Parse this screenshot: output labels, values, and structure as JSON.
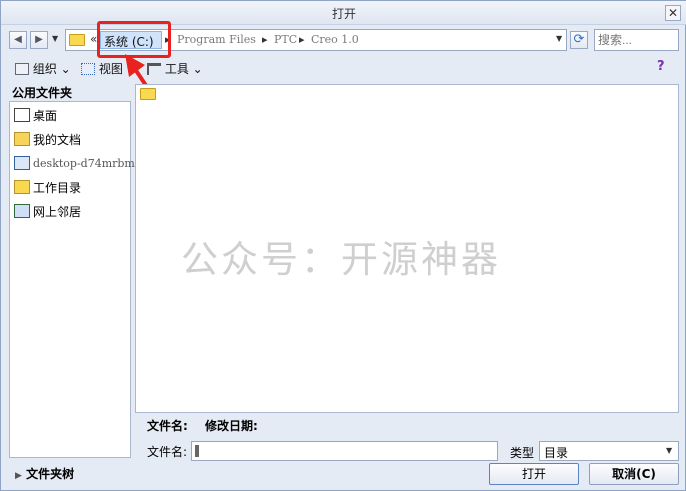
{
  "window": {
    "title": "打开",
    "close_glyph": "✕"
  },
  "nav": {
    "back_glyph": "◀",
    "forward_glyph": "▶",
    "dropdown_glyph": "▼",
    "refresh_glyph": "⟳"
  },
  "address": {
    "overflow_glyph": "«",
    "selected": "系统 (C:)",
    "sep": "▸",
    "crumbs": [
      "Program Files",
      "PTC",
      "Creo 1.0"
    ],
    "dropdown_glyph": "▼"
  },
  "search": {
    "placeholder": "搜索..."
  },
  "toolbar": {
    "organize": "组织",
    "view": "视图",
    "tools": "工具",
    "chevron": "⌄",
    "help_glyph": "?"
  },
  "sidebar": {
    "header": "公用文件夹",
    "items": [
      {
        "label": "桌面",
        "icon": "desktop-icon"
      },
      {
        "label": "我的文档",
        "icon": "documents-icon"
      },
      {
        "label": "desktop-d74mrbm",
        "icon": "computer-icon"
      },
      {
        "label": "工作目录",
        "icon": "working-directory-icon"
      },
      {
        "label": "网上邻居",
        "icon": "network-icon"
      }
    ],
    "folder_tree_label": "文件夹树",
    "folder_tree_glyph": "▶"
  },
  "file_list": {
    "watermark": "公众号：开源神器",
    "col_name": "文件名:",
    "col_modified": "修改日期:"
  },
  "bottom": {
    "filename_label": "文件名:",
    "filename_value": "",
    "type_label": "类型",
    "type_value": "目录",
    "open_button": "打开",
    "cancel_button": "取消(C)"
  },
  "colors": {
    "annotation": "#e8231f",
    "selection": "#cfe3fb"
  }
}
